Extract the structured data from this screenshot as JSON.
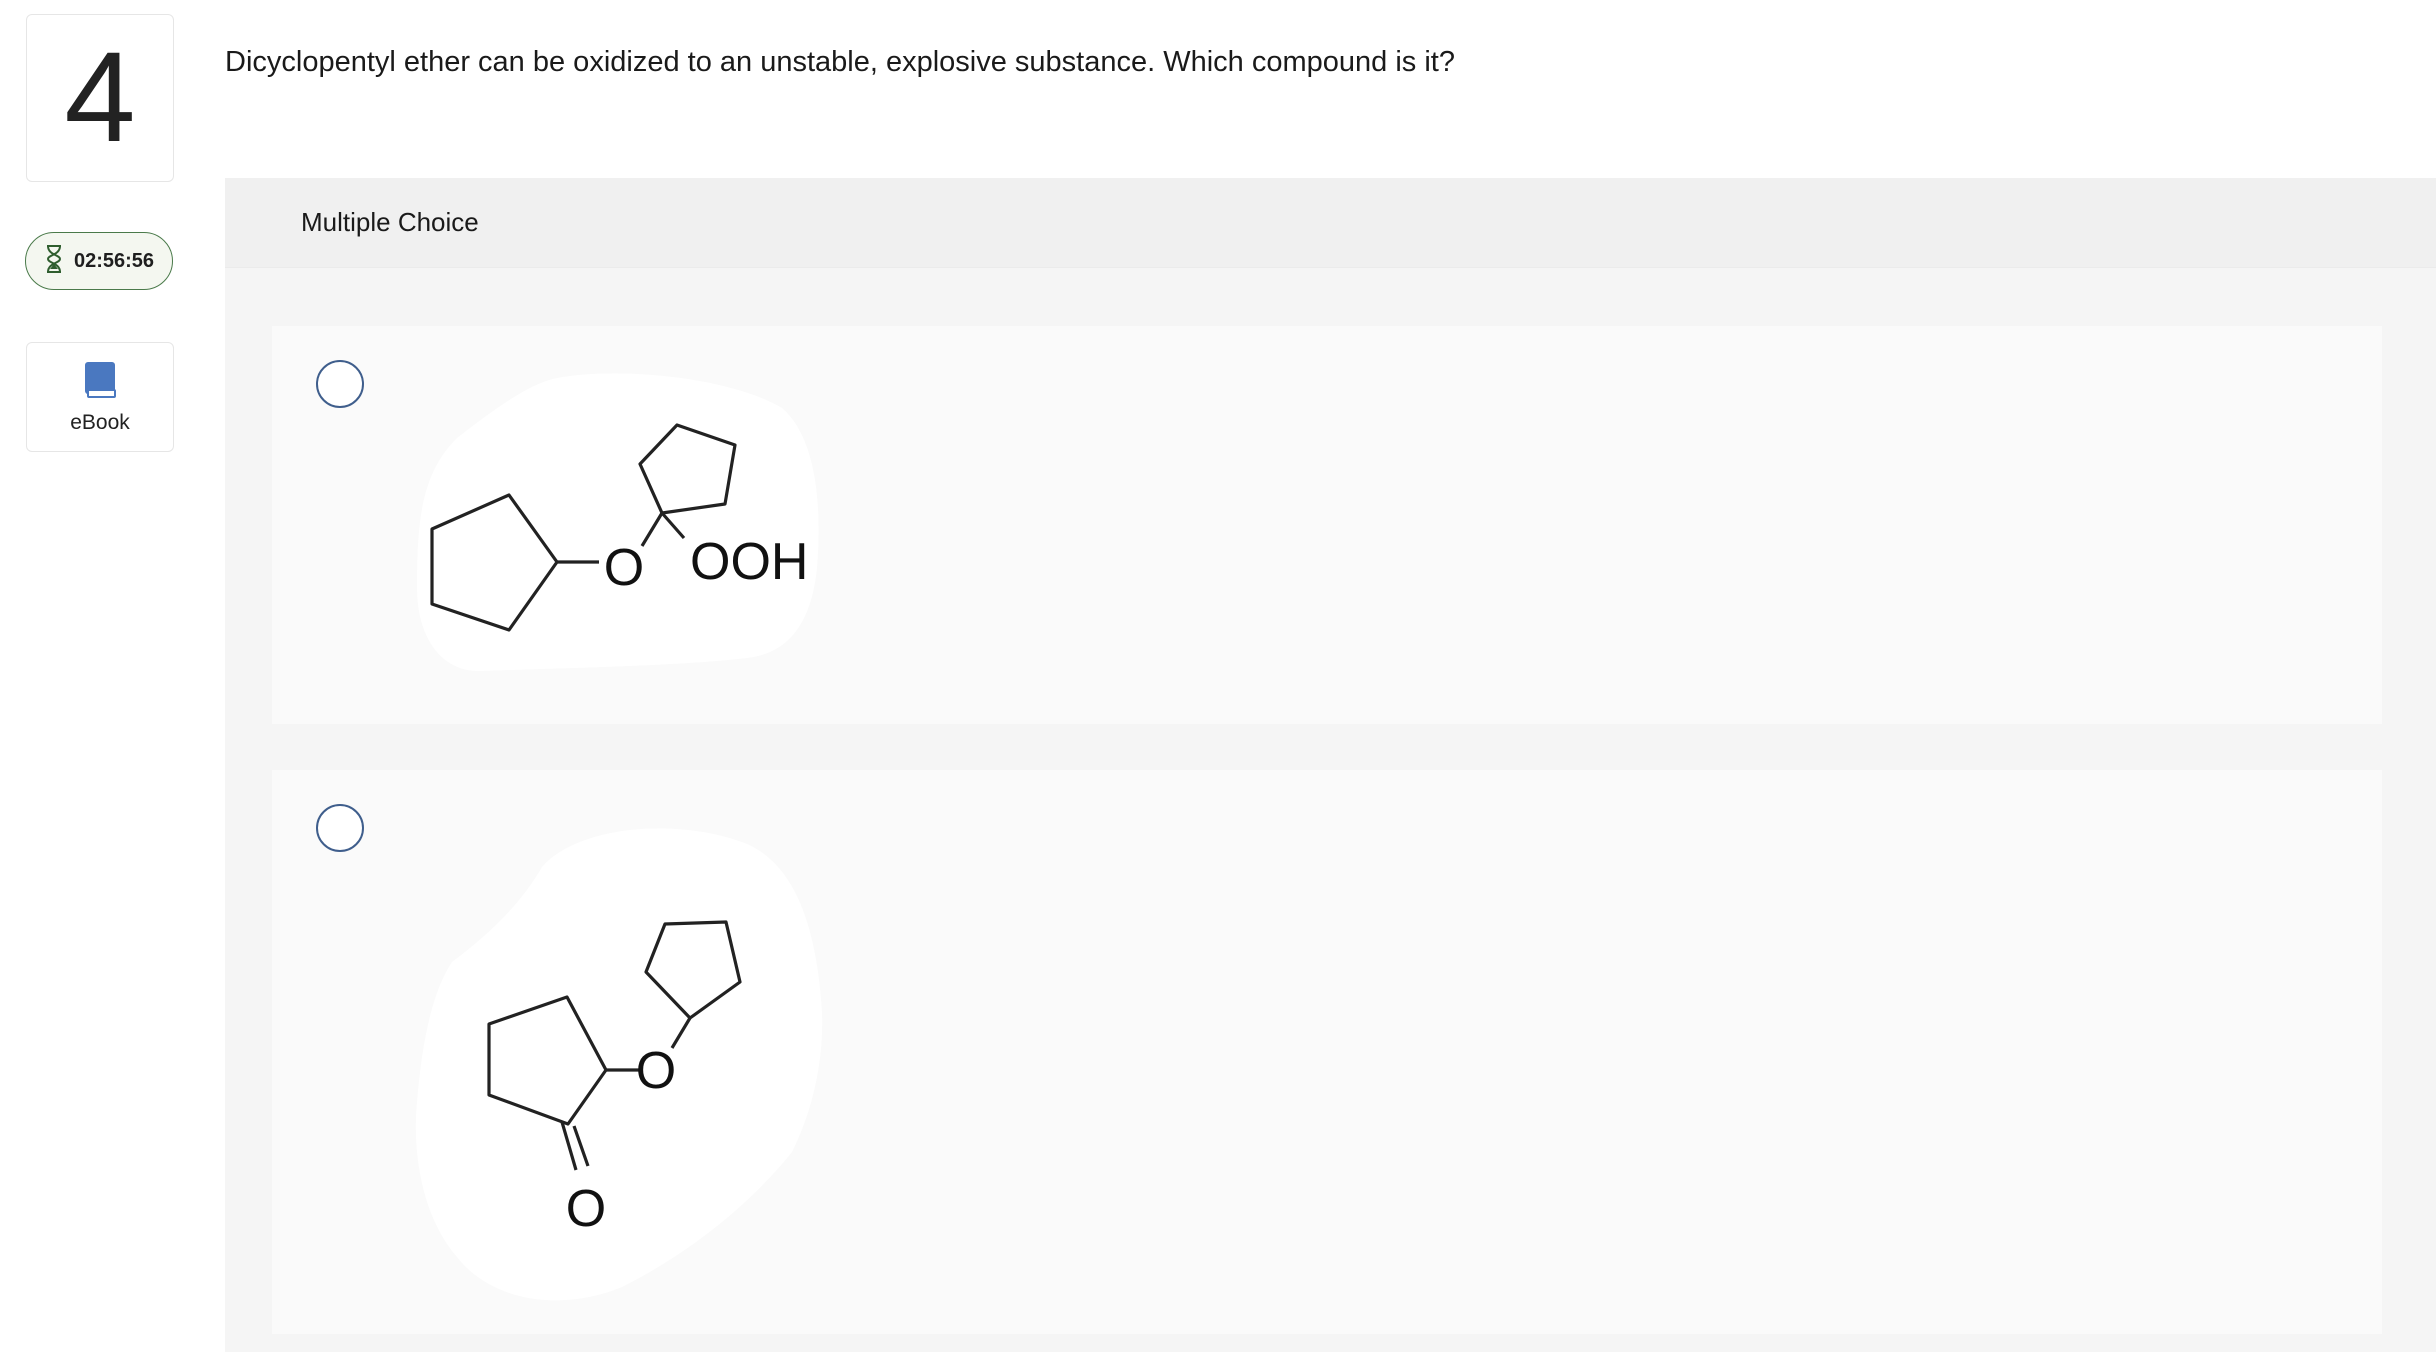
{
  "question": {
    "number": "4",
    "text": "Dicyclopentyl ether can be oxidized to an unstable, explosive substance. Which compound is it?"
  },
  "sidebar": {
    "timer": "02:56:56",
    "ebook_label": "eBook"
  },
  "panel": {
    "title": "Multiple Choice"
  },
  "choices": [
    {
      "atoms": {
        "o_ether": "O",
        "ooh": "OOH"
      }
    },
    {
      "atoms": {
        "o_ether": "O",
        "o_ketone": "O"
      }
    }
  ],
  "colors": {
    "timer_border": "#4a7a4a",
    "radio_border": "#3f5e8c",
    "ebook_icon": "#4a78c0"
  }
}
